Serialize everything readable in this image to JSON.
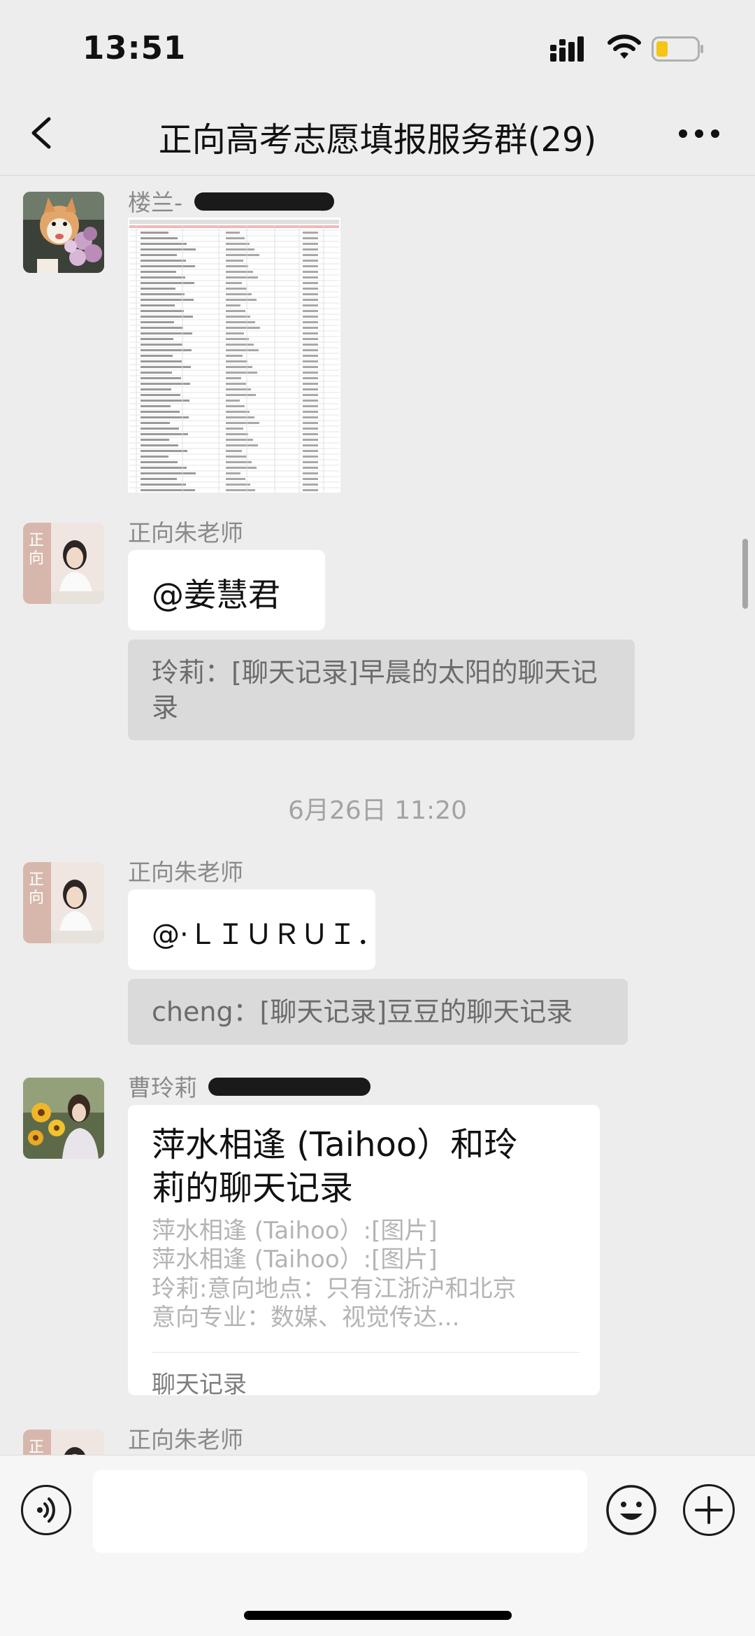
{
  "status_bar": {
    "time": "13:51",
    "icons": [
      "signal-icon",
      "wifi-icon",
      "battery-icon"
    ]
  },
  "header": {
    "title": "正向高考志愿填报服务群(29)",
    "back_icon": "chevron-left-icon",
    "more_icon": "more-dots-icon"
  },
  "messages": [
    {
      "sender": "楼兰-",
      "sender_suffix": "0",
      "type": "image",
      "image": "spreadsheet-screenshot"
    },
    {
      "sender": "正向朱老师",
      "type": "text",
      "text": "@姜慧君",
      "quote": "玲莉：[聊天记录]早晨的太阳的聊天记录"
    },
    {
      "timestamp": "6月26日 11:20"
    },
    {
      "sender": "正向朱老师",
      "type": "text",
      "text": "@·ＬＩＵＲＵＩ．",
      "quote": "cheng：[聊天记录]豆豆的聊天记录"
    },
    {
      "sender": "曹玲莉",
      "type": "chat_record_card",
      "card": {
        "title": "萍水相逢 (Taihoo）和玲莉的聊天记录",
        "lines": [
          "萍水相逢 (Taihoo）:[图片]",
          "萍水相逢 (Taihoo）:[图片]",
          "玲莉:意向地点：只有江浙沪和北京",
          "意向专业：数媒、视觉传达..."
        ],
        "footer": "聊天记录"
      }
    },
    {
      "sender": "正向朱老师",
      "type": "partial"
    }
  ],
  "input_bar": {
    "voice_icon": "voice-icon",
    "input_value": "",
    "emoji_icon": "emoji-icon",
    "plus_icon": "plus-icon"
  },
  "colors": {
    "background": "#ededed",
    "bubble": "#ffffff",
    "quote": "#dadada",
    "meta_text": "#8a8a8a"
  }
}
